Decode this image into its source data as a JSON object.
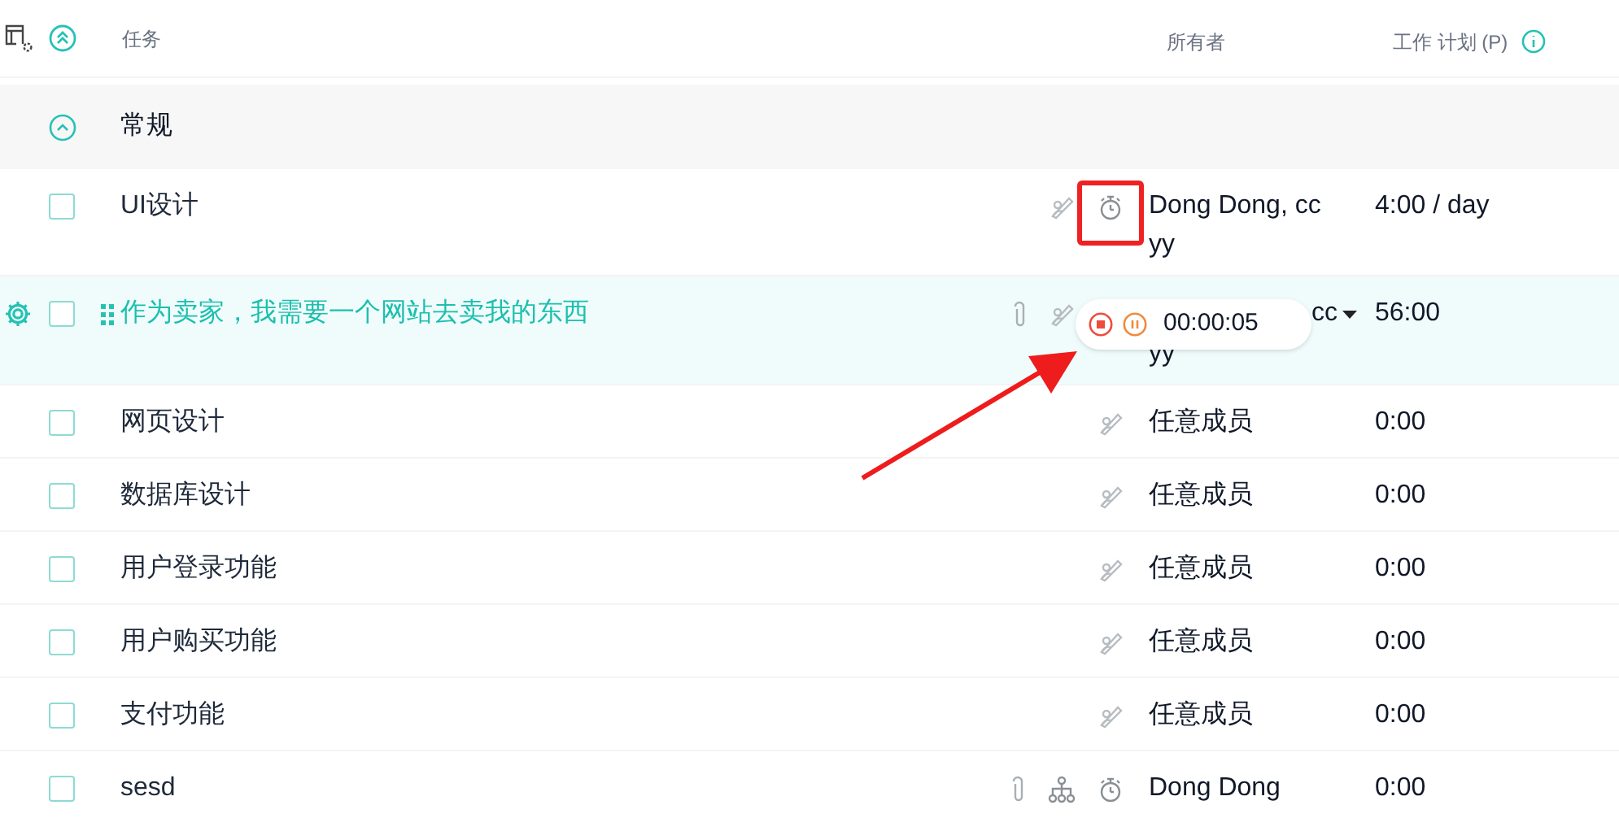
{
  "header": {
    "columns": [
      "任务",
      "所有者",
      "工作 计划 (P)"
    ]
  },
  "group": {
    "title": "常规",
    "expanded": true
  },
  "tasks": [
    {
      "name": "UI设计",
      "highlighted": false,
      "checked": false,
      "icons": [
        {
          "kind": "assign"
        },
        {
          "kind": "timer"
        }
      ],
      "timer_annotated": true,
      "owner": "Dong Dong, cc yy",
      "plan": "4:00 / day"
    },
    {
      "name": "作为卖家，我需要一个网站去卖我的东西",
      "highlighted": true,
      "checked": false,
      "icons": [
        {
          "kind": "attachment"
        },
        {
          "kind": "assign"
        }
      ],
      "timer_annotated": false,
      "running_timer": {
        "time": "00:00:05"
      },
      "owner_visible": [
        "cc",
        "yy"
      ],
      "owner_dropdown": true,
      "plan": "56:00"
    },
    {
      "name": "网页设计",
      "highlighted": false,
      "checked": false,
      "icons": [
        {
          "kind": "assign"
        }
      ],
      "timer_annotated": false,
      "owner": "任意成员",
      "plan": "0:00"
    },
    {
      "name": "数据库设计",
      "highlighted": false,
      "checked": false,
      "icons": [
        {
          "kind": "assign"
        }
      ],
      "timer_annotated": false,
      "owner": "任意成员",
      "plan": "0:00"
    },
    {
      "name": "用户登录功能",
      "highlighted": false,
      "checked": false,
      "icons": [
        {
          "kind": "assign"
        }
      ],
      "timer_annotated": false,
      "owner": "任意成员",
      "plan": "0:00"
    },
    {
      "name": "用户购买功能",
      "highlighted": false,
      "checked": false,
      "icons": [
        {
          "kind": "assign"
        }
      ],
      "timer_annotated": false,
      "owner": "任意成员",
      "plan": "0:00"
    },
    {
      "name": "支付功能",
      "highlighted": false,
      "checked": false,
      "icons": [
        {
          "kind": "assign"
        }
      ],
      "timer_annotated": false,
      "owner": "任意成员",
      "plan": "0:00"
    },
    {
      "name": "sesd",
      "highlighted": false,
      "checked": false,
      "icons": [
        {
          "kind": "attachment"
        },
        {
          "kind": "subtask"
        },
        {
          "kind": "timer"
        }
      ],
      "timer_annotated": false,
      "owner": "Dong Dong",
      "plan": "0:00"
    }
  ]
}
